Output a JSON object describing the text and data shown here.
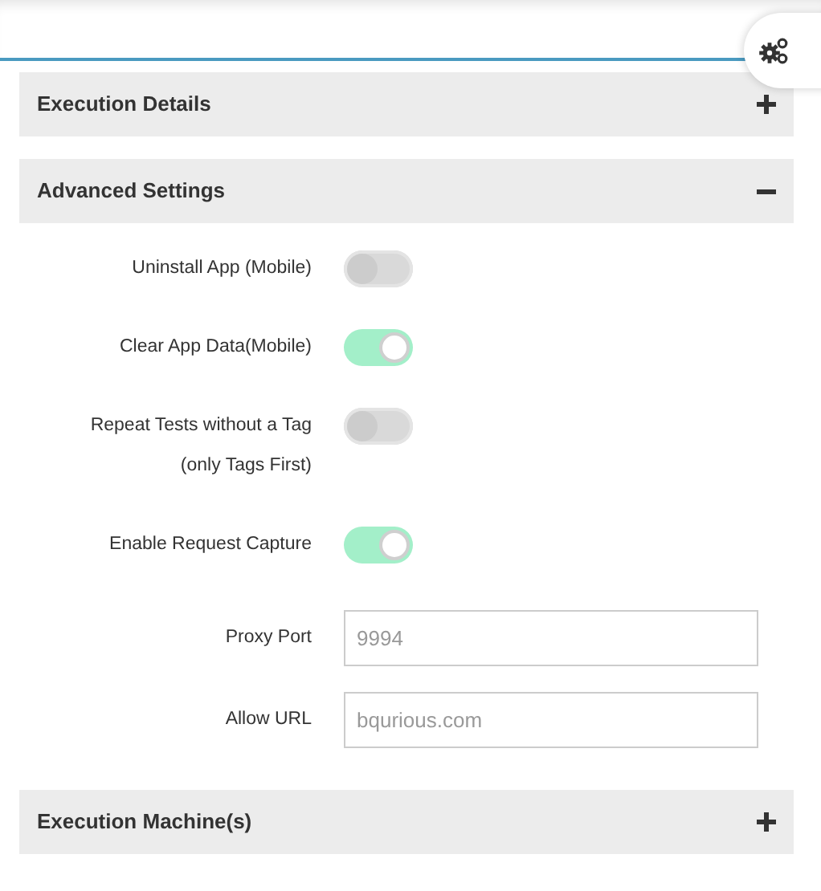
{
  "sections": [
    {
      "title": "Execution Details",
      "expanded": false
    },
    {
      "title": "Advanced Settings",
      "expanded": true,
      "fields": [
        {
          "kind": "toggle",
          "label": "Uninstall App (Mobile)",
          "on": false
        },
        {
          "kind": "toggle",
          "label": "Clear App Data(Mobile)",
          "on": true
        },
        {
          "kind": "toggle",
          "label": "Repeat Tests without a Tag",
          "label_line_2": "(only Tags First)",
          "on": false
        },
        {
          "kind": "toggle",
          "label": "Enable Request Capture",
          "on": true
        },
        {
          "kind": "input",
          "label": "Proxy Port",
          "placeholder": "9994"
        },
        {
          "kind": "input",
          "label": "Allow URL",
          "placeholder": "bqurious.com"
        }
      ]
    },
    {
      "title": "Execution Machine(s)",
      "expanded": false
    }
  ]
}
